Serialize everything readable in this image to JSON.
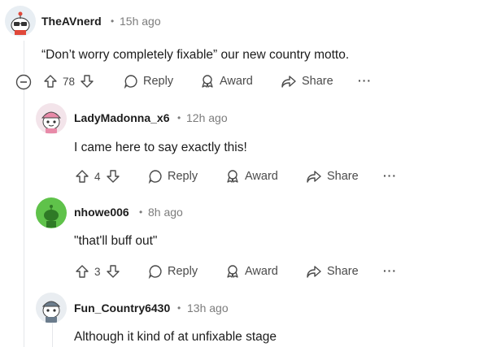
{
  "comments": [
    {
      "username": "TheAVnerd",
      "time": "15h ago",
      "text": "“Don’t worry completely fixable” our new country motto.",
      "votes": "78",
      "avatar_icon": "snoo-avatar-glasses",
      "avatar_color": "#e8eef3"
    },
    {
      "username": "LadyMadonna_x6",
      "time": "12h ago",
      "text": "I came here to say exactly this!",
      "votes": "4",
      "avatar_icon": "snoo-avatar-pink-hat",
      "avatar_color": "#f3e4ea"
    },
    {
      "username": "nhowe006",
      "time": "8h ago",
      "text": "\"that'll buff out\"",
      "votes": "3",
      "avatar_icon": "snoo-avatar-green",
      "avatar_color": "#5fc24a"
    },
    {
      "username": "Fun_Country6430",
      "time": "13h ago",
      "text": "Although it kind of at unfixable stage",
      "avatar_icon": "snoo-avatar-helmet",
      "avatar_color": "#e9edf1"
    }
  ],
  "actions": {
    "separator": "•",
    "reply": "Reply",
    "award": "Award",
    "share": "Share",
    "more": "···"
  }
}
